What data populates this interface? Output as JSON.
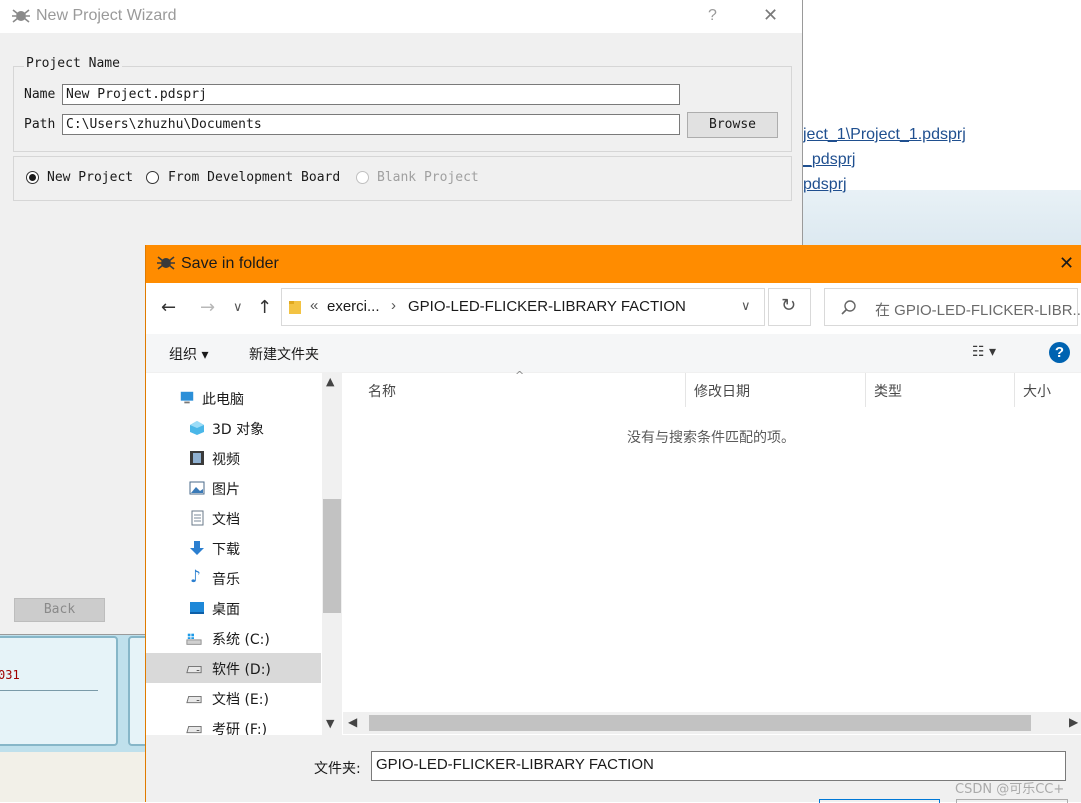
{
  "background": {
    "recent_projects": [
      "ject_1\\Project_1.pdsprj",
      "_pdsprj",
      "pdsprj"
    ],
    "side_fragment": "031"
  },
  "wizard": {
    "title": "New Project Wizard",
    "help_label": "?",
    "close_label": "✕",
    "project_name_group_label": "Project Name",
    "name_label": "Name",
    "name_value": "New Project.pdsprj",
    "path_label": "Path",
    "path_value": "C:\\Users\\zhuzhu\\Documents",
    "browse_label": "Browse",
    "project_types": [
      {
        "label": "New Project",
        "checked": true,
        "enabled": true
      },
      {
        "label": "From Development Board",
        "checked": false,
        "enabled": true
      },
      {
        "label": "Blank Project",
        "checked": false,
        "enabled": false
      }
    ],
    "back_label": "Back"
  },
  "save_dialog": {
    "title": "Save in folder",
    "close_label": "✕",
    "nav": {
      "back": "←",
      "forward": "→",
      "recent": "∨",
      "up": "↑"
    },
    "address": {
      "prefix": "«",
      "parent": "exerci...",
      "separator": "›",
      "current": "GPIO-LED-FLICKER-LIBRARY FACTION",
      "dropdown": "∨"
    },
    "refresh_label": "↻",
    "search_placeholder": "在 GPIO-LED-FLICKER-LIBR...",
    "toolbar": {
      "organize": "组织 ▾",
      "new_folder": "新建文件夹",
      "view": "☷ ▾",
      "help": "?"
    },
    "tree": [
      {
        "label": "此电脑",
        "icon": "computer-icon",
        "selected": false
      },
      {
        "label": "3D 对象",
        "icon": "cube-icon",
        "selected": false
      },
      {
        "label": "视频",
        "icon": "video-icon",
        "selected": false
      },
      {
        "label": "图片",
        "icon": "picture-icon",
        "selected": false
      },
      {
        "label": "文档",
        "icon": "document-icon",
        "selected": false
      },
      {
        "label": "下载",
        "icon": "download-icon",
        "selected": false
      },
      {
        "label": "音乐",
        "icon": "music-icon",
        "selected": false
      },
      {
        "label": "桌面",
        "icon": "desktop-icon",
        "selected": false
      },
      {
        "label": "系统 (C:)",
        "icon": "windows-drive-icon",
        "selected": false
      },
      {
        "label": "软件 (D:)",
        "icon": "drive-icon",
        "selected": true
      },
      {
        "label": "文档 (E:)",
        "icon": "drive-icon",
        "selected": false
      },
      {
        "label": "考研 (F:)",
        "icon": "drive-icon",
        "selected": false
      }
    ],
    "columns": [
      "名称",
      "修改日期",
      "类型",
      "大小"
    ],
    "empty_message": "没有与搜索条件匹配的项。",
    "folder_label": "文件夹:",
    "folder_value": "GPIO-LED-FLICKER-LIBRARY FACTION"
  },
  "watermark": "CSDN @可乐CC+",
  "colors": {
    "save_titlebar": "#ff8c00",
    "selection": "#d9d9d9",
    "help_blue": "#0063b1",
    "link": "#1f4f8f"
  }
}
